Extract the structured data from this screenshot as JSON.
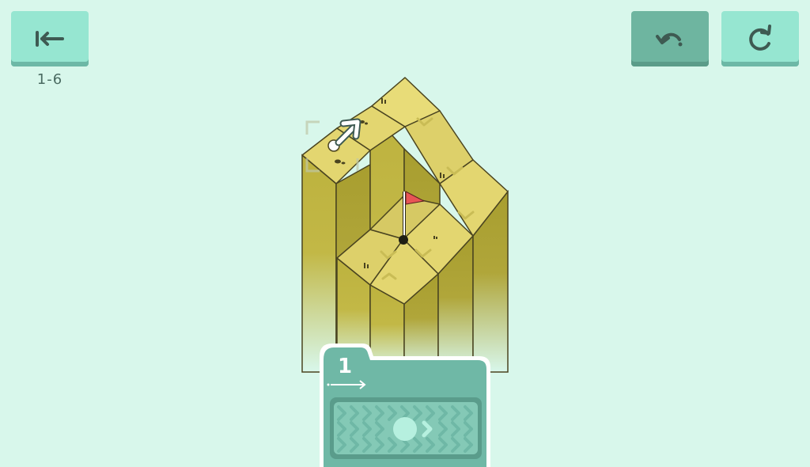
{
  "toolbar": {
    "back_icon": "arrow-to-left-icon",
    "undo_icon": "undo-icon",
    "restart_icon": "restart-icon"
  },
  "level": {
    "label": "1-6"
  },
  "move_card": {
    "count": "1",
    "direction_icon": "arrow-right-icon",
    "track_icon": "chevron-track-icon"
  },
  "colors": {
    "background": "#d8f7eb",
    "button": "#96e6d1",
    "button_dark": "#6eb5a0",
    "grass_top": "#e3d670",
    "pillar_side": "#bdb23e",
    "flag": "#e85555",
    "card": "#6fb8a6"
  }
}
